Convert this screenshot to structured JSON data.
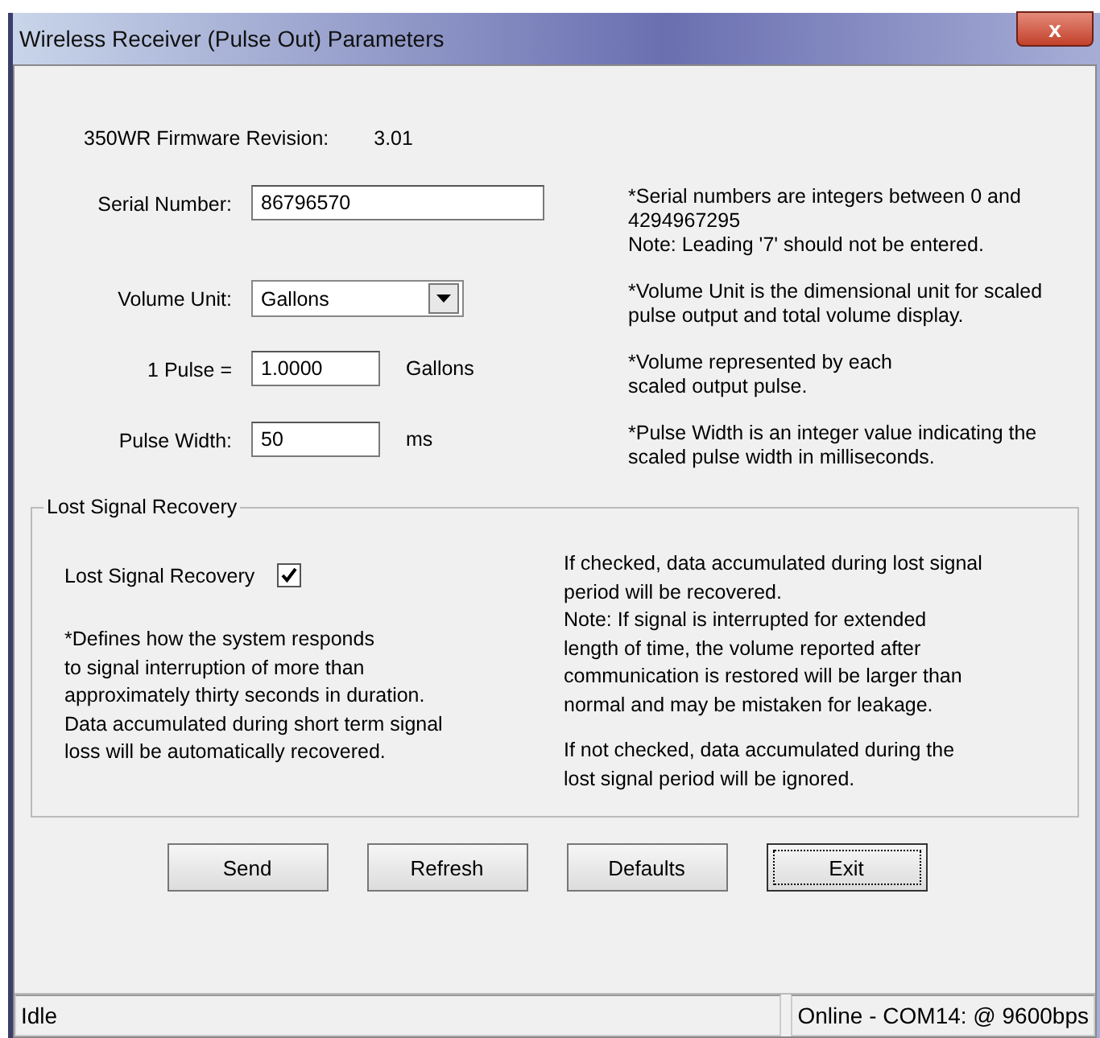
{
  "window": {
    "title": "Wireless Receiver (Pulse Out) Parameters",
    "close": "x"
  },
  "firmware": {
    "label": "350WR Firmware Revision:",
    "value": "3.01"
  },
  "rows": [
    {
      "kind": "input",
      "label": "Serial Number:",
      "value": "86796570",
      "help": "*Serial numbers are integers between 0 and 4294967295\nNote: Leading '7' should not be entered."
    },
    {
      "kind": "dropdown",
      "label": "Volume Unit:",
      "value": "Gallons",
      "help": "*Volume Unit is the dimensional unit for scaled pulse output and total volume display."
    },
    {
      "kind": "input",
      "label": "1 Pulse =",
      "value": "1.0000",
      "unit": "Gallons",
      "help": "*Volume represented by each\nscaled output pulse."
    },
    {
      "kind": "input",
      "label": "Pulse Width:",
      "value": "50",
      "unit": "ms",
      "help": "*Pulse Width is an integer value indicating the scaled pulse width in milliseconds."
    }
  ],
  "group": {
    "title": "Lost Signal Recovery",
    "checkbox": {
      "label": "Lost Signal Recovery",
      "checked": true
    },
    "left_note": "*Defines how the system responds\nto signal interruption of more than\napproximately thirty seconds in duration.\nData accumulated during short term signal\nloss will be automatically recovered.",
    "right_notes": [
      "If checked, data accumulated during lost signal\nperiod will be recovered.\nNote:  If signal is interrupted for extended\nlength of time, the volume reported after\ncommunication is restored will be larger than\nnormal and may be mistaken for leakage.",
      "If not checked, data accumulated during the\nlost signal period will be ignored."
    ]
  },
  "buttons": [
    {
      "label": "Send",
      "focused": false
    },
    {
      "label": "Refresh",
      "focused": false
    },
    {
      "label": "Defaults",
      "focused": false
    },
    {
      "label": "Exit",
      "focused": true
    }
  ],
  "status_bar": [
    "Idle",
    "Online - COM14: @ 9600bps"
  ]
}
